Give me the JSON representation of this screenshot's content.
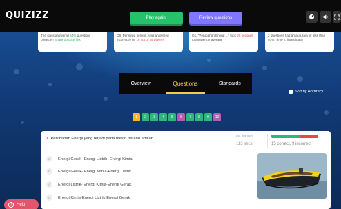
{
  "app": {
    "logo": "QUIZIZZ"
  },
  "topbar": {
    "play_again_label": "Play again!",
    "review_label": "Review questions",
    "icons": [
      "theme-icon",
      "sound-icon",
      "fullscreen-icon"
    ]
  },
  "cards": [
    {
      "text_a": "The class answered ",
      "text_b": "54%",
      "text_c": " questions correctly! ",
      "text_d": "Share practice link"
    },
    {
      "text_a": "Q6. Peristiwa berikut...was answered incorrectly by ",
      "text_b": "16 out of 25 players",
      "text_c": "",
      "text_d": ""
    },
    {
      "text_a": "Q1. \"Perubahan Energi ...\" took ",
      "text_b": "26 seconds",
      "text_c": " to answer on average",
      "text_d": ""
    },
    {
      "text_a": "2 questions had an accuracy of less than 40%. Time to investigate!",
      "text_b": "",
      "text_c": "",
      "text_d": ""
    }
  ],
  "tabs": [
    {
      "label": "Overview"
    },
    {
      "label": "Questions"
    },
    {
      "label": "Standards"
    }
  ],
  "sort": {
    "label": "Sort by Accuracy"
  },
  "pills": [
    "1",
    "2",
    "3",
    "4",
    "5",
    "6",
    "7",
    "8",
    "9",
    "10"
  ],
  "question": {
    "text": "1. Perubahan Energi yang terjadi pada mesin perahu adalah ....",
    "avg_time_label": "Avg. time taken",
    "avg_time_value": "113 secs",
    "correct_fraction": 0.6,
    "accuracy_text": "15 correct, 9 incorrect",
    "options": [
      {
        "letter": "a",
        "text": "Energi Gerak- Energi Listrik- Energi Kimia"
      },
      {
        "letter": "b",
        "text": "Energi Gerak- Energi Kimia-Energi Listrik"
      },
      {
        "letter": "c",
        "text": "Energi Listrik- Energi Kimia-Energi Gerak"
      },
      {
        "letter": "d",
        "text": "Energi Kimia-Energi Listrik-Energi Gerak"
      }
    ]
  },
  "help": {
    "label": "Help"
  },
  "colors": {
    "play": "#25c26b",
    "review": "#7f77ff",
    "accent": "#f2c94c",
    "help": "#e2556b"
  }
}
